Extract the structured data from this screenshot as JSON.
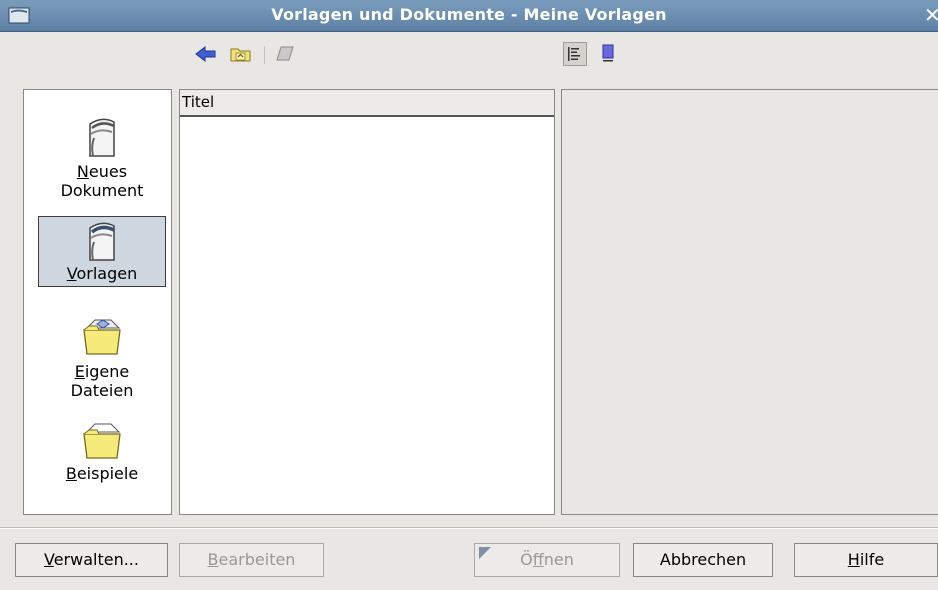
{
  "window": {
    "title": "Vorlagen und Dokumente - Meine Vorlagen",
    "close_glyph": "✕"
  },
  "toolbar": {
    "icons": [
      "back-arrow-icon",
      "up-folder-icon",
      "print-icon",
      "details-view-icon",
      "document-preview-icon"
    ]
  },
  "nav": {
    "items": [
      {
        "accel": "N",
        "rest_line1": "eues",
        "line2": "Dokument",
        "icon": "new-document-icon",
        "selected": false
      },
      {
        "accel": "V",
        "rest_line1": "orlagen",
        "line2": "",
        "icon": "templates-icon",
        "selected": true
      },
      {
        "accel": "E",
        "rest_line1": "igene",
        "line2": "Dateien",
        "icon": "my-documents-folder-icon",
        "selected": false
      },
      {
        "accel": "B",
        "rest_line1": "eispiele",
        "line2": "",
        "icon": "samples-folder-icon",
        "selected": false
      }
    ]
  },
  "list": {
    "column_header": "Titel"
  },
  "buttons": {
    "manage": {
      "accel": "V",
      "rest": "erwalten..."
    },
    "edit": {
      "accel": "B",
      "rest": "earbeiten"
    },
    "open": {
      "pre": "Ö",
      "accel": "f",
      "rest": "fnen"
    },
    "cancel": {
      "label": "Abbrechen"
    },
    "help": {
      "accel": "H",
      "rest": "ilfe"
    }
  },
  "colors": {
    "titlebar": "#6b8db0",
    "selection": "#cfd7e1",
    "arrow": "#3f5fd0"
  }
}
